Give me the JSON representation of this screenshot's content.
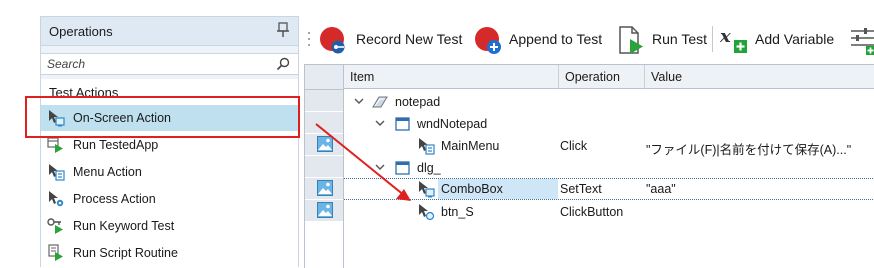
{
  "operations": {
    "title": "Operations",
    "search_placeholder": "Search",
    "group_label": "Test Actions",
    "items": [
      {
        "label": "On-Screen Action",
        "icon": "on-screen-action-icon"
      },
      {
        "label": "Run TestedApp",
        "icon": "run-testedapp-icon"
      },
      {
        "label": "Menu Action",
        "icon": "menu-action-icon"
      },
      {
        "label": "Process Action",
        "icon": "process-action-icon"
      },
      {
        "label": "Run Keyword Test",
        "icon": "run-keyword-test-icon"
      },
      {
        "label": "Run Script Routine",
        "icon": "run-script-routine-icon"
      }
    ]
  },
  "toolbar": {
    "record_new_test": "Record New Test",
    "append_to_test": "Append to Test",
    "run_test": "Run Test",
    "add_variable": "Add Variable"
  },
  "grid": {
    "columns": [
      "Item",
      "Operation",
      "Value"
    ],
    "rows": [
      {
        "item": "notepad",
        "operation": "",
        "value": ""
      },
      {
        "item": "wndNotepad",
        "operation": "",
        "value": ""
      },
      {
        "item": "MainMenu",
        "operation": "Click",
        "value": "\"ファイル(F)|名前を付けて保存(A)...\""
      },
      {
        "item": "dlg_",
        "operation": "",
        "value": ""
      },
      {
        "item": "ComboBox",
        "operation": "SetText",
        "value": "\"aaa\""
      },
      {
        "item": "btn_S",
        "operation": "ClickButton",
        "value": ""
      }
    ]
  },
  "colors": {
    "accent": "#3a6ea5",
    "selection": "#bfe0ee",
    "highlight_red": "#e02020",
    "record_red": "#d42a2a",
    "add_green": "#22a33a"
  }
}
